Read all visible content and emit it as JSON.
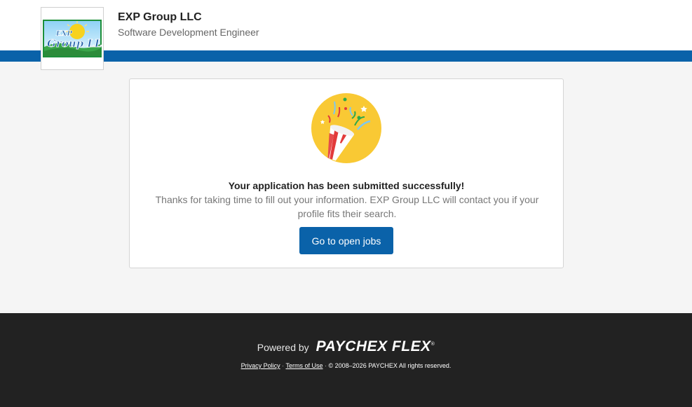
{
  "header": {
    "company_name": "EXP Group LLC",
    "job_title": "Software Development Engineer",
    "logo_text_top": "EXP",
    "logo_text_main": "Group LLC",
    "accent_color": "#0a62a9"
  },
  "card": {
    "icon": "party-popper-icon",
    "title": "Your application has been submitted successfully!",
    "message": "Thanks for taking time to fill out your information. EXP Group LLC will contact you if your profile fits their search.",
    "button_label": "Go to open jobs"
  },
  "footer": {
    "powered_by": "Powered by",
    "brand": "PAYCHEX FLEX",
    "brand_mark": "®",
    "privacy_link": "Privacy Policy",
    "separator": "·",
    "terms_link": "Terms of Use",
    "copyright": "© 2008–2026 PAYCHEX All rights reserved."
  }
}
